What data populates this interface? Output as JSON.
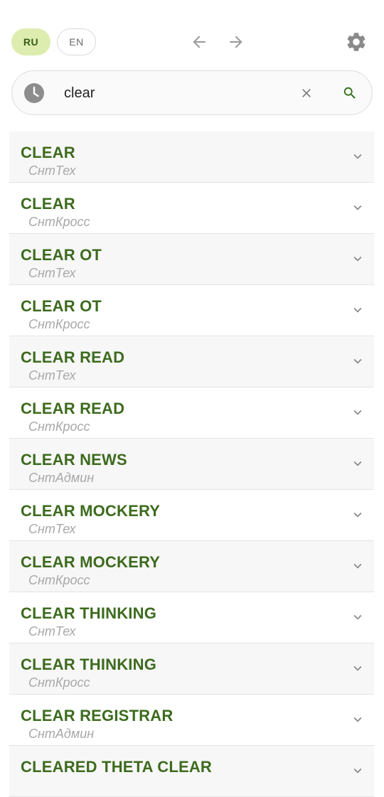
{
  "header": {
    "lang_ru": "RU",
    "lang_en": "EN"
  },
  "search": {
    "value": "clear",
    "placeholder": ""
  },
  "colors": {
    "accent_green": "#3d6b1e",
    "lang_active_bg": "#dcedaf",
    "subtitle_gray": "#a8a8a8"
  },
  "icons": {
    "back": "arrow-left-icon",
    "forward": "arrow-right-icon",
    "settings": "gear-icon",
    "history": "clock-icon",
    "clear": "close-icon",
    "search": "search-icon",
    "expand": "chevron-down-icon"
  },
  "results": [
    {
      "title": "CLEAR",
      "source": "СнтТех"
    },
    {
      "title": "CLEAR",
      "source": "СнтКросс"
    },
    {
      "title": "CLEAR OT",
      "source": "СнтТех"
    },
    {
      "title": "CLEAR OT",
      "source": "СнтКросс"
    },
    {
      "title": "CLEAR READ",
      "source": "СнтТех"
    },
    {
      "title": "CLEAR READ",
      "source": "СнтКросс"
    },
    {
      "title": "CLEAR NEWS",
      "source": "СнтАдмин"
    },
    {
      "title": "CLEAR MOCKERY",
      "source": "СнтТех"
    },
    {
      "title": "CLEAR MOCKERY",
      "source": "СнтКросс"
    },
    {
      "title": "CLEAR THINKING",
      "source": "СнтТех"
    },
    {
      "title": "CLEAR THINKING",
      "source": "СнтКросс"
    },
    {
      "title": "CLEAR REGISTRAR",
      "source": "СнтАдмин"
    },
    {
      "title": "CLEARED THETA CLEAR",
      "source": ""
    }
  ]
}
